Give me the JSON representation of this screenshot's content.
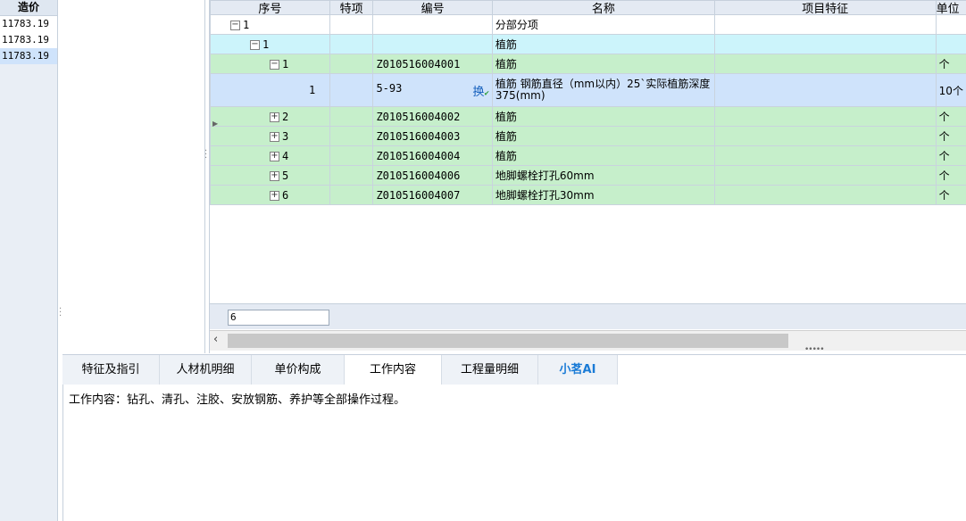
{
  "left_panel": {
    "header": "造价",
    "values": [
      "11783.19",
      "11783.19",
      "11783.19"
    ]
  },
  "grid": {
    "columns": [
      "序号",
      "特项",
      "编号",
      "名称",
      "项目特征",
      "单位"
    ],
    "rows": [
      {
        "toggle": "⊟",
        "seq": "1",
        "code": "",
        "name": "分部分项",
        "unit": ""
      },
      {
        "toggle": "⊟",
        "seq": "1",
        "code": "",
        "name": "植筋",
        "unit": ""
      },
      {
        "toggle": "⊟",
        "seq": "1",
        "code": "Z010516004001",
        "name": "植筋",
        "unit": "个"
      },
      {
        "toggle": "",
        "seq": "1",
        "code": "5-93",
        "name": "植筋 钢筋直径（mm以内）25`实际植筋深度375(mm)",
        "unit": "10个",
        "swap_label": "换"
      },
      {
        "toggle": "⊞",
        "seq": "2",
        "code": "Z010516004002",
        "name": "植筋",
        "unit": "个"
      },
      {
        "toggle": "⊞",
        "seq": "3",
        "code": "Z010516004003",
        "name": "植筋",
        "unit": "个"
      },
      {
        "toggle": "⊞",
        "seq": "4",
        "code": "Z010516004004",
        "name": "植筋",
        "unit": "个"
      },
      {
        "toggle": "⊞",
        "seq": "5",
        "code": "Z010516004006",
        "name": "地脚螺栓打孔60mm",
        "unit": "个"
      },
      {
        "toggle": "⊞",
        "seq": "6",
        "code": "Z010516004007",
        "name": "地脚螺栓打孔30mm",
        "unit": "个"
      }
    ],
    "row_count_value": "6"
  },
  "tabs": [
    "特征及指引",
    "人材机明细",
    "单价构成",
    "工作内容",
    "工程量明细",
    "小茗AI"
  ],
  "active_tab": "工作内容",
  "content": {
    "text": "工作内容：钻孔、清孔、注胶、安放钢筋、养护等全部操作过程。"
  },
  "colors": {
    "green_row": "#c6efcb",
    "cyan_row": "#ccf4fb",
    "selected_row": "#cfe3fb",
    "ai_tab": "#1a7bd6"
  }
}
